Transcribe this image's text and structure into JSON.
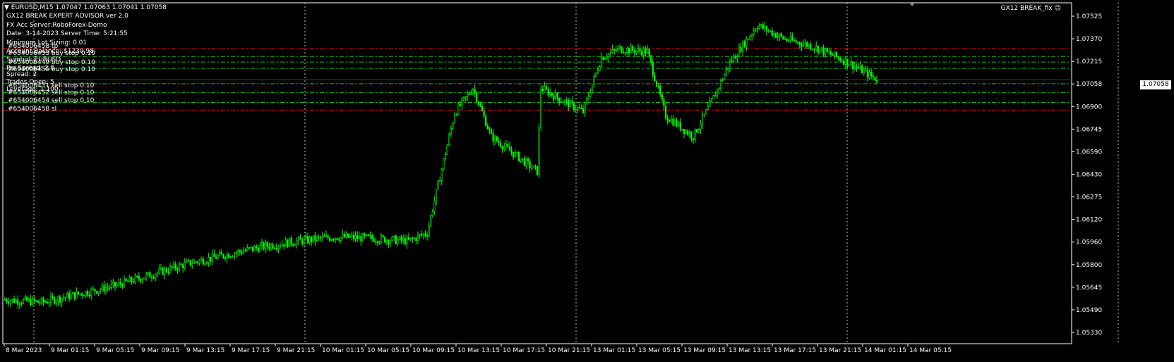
{
  "header": {
    "symbol_line": "EURUSD,M15  1.07047 1.07063 1.07041 1.07058",
    "ea_name": "GX12 BREAK_fix"
  },
  "ea_info": [
    "GX12 BREAK EXPERT ADVISOR ver 2.0",
    "FX Acc Server:RoboForex-Demo",
    "Date: 3-14-2023 Server Time: 5:21:55",
    "Minimum Lot Sizing: 0.01",
    "Account Balance:  $1230.98",
    "Symbol: EURUSD",
    "Pip Spread:  2.0",
    "Spread: 2",
    "Trades Open: 5",
    "Leverage: 1:100"
  ],
  "orders": [
    "#654006458 tp",
    "#654006453 buy stop 0.10",
    "#654006449 buy stop 0.10",
    "#654006455 buy stop 0.10",
    "#654006451 sell stop 0.10",
    "#654006452 sell stop 0.10",
    "#654006454 sell stop 0.10",
    "#654006458 sl"
  ],
  "current_price": "1.07058",
  "colors": {
    "background": "#000000",
    "candle": "#00ff00",
    "grid": "#c0c0c0",
    "tp_sl_line": "#ff0000",
    "order_line": "#00c800",
    "text": "#ffffff"
  },
  "chart_data": {
    "type": "candlestick",
    "symbol": "EURUSD",
    "timeframe": "M15",
    "ylim": [
      1.0533,
      1.0755
    ],
    "y_ticks": [
      "1.07525",
      "1.07370",
      "1.07215",
      "1.07058",
      "1.06900",
      "1.06745",
      "1.06590",
      "1.06430",
      "1.06275",
      "1.06120",
      "1.05960",
      "1.05800",
      "1.05645",
      "1.05490",
      "1.05330"
    ],
    "x_ticks": [
      "8 Mar 2023",
      "9 Mar 01:15",
      "9 Mar 05:15",
      "9 Mar 09:15",
      "9 Mar 13:15",
      "9 Mar 17:15",
      "9 Mar 21:15",
      "10 Mar 01:15",
      "10 Mar 05:15",
      "10 Mar 09:15",
      "10 Mar 13:15",
      "10 Mar 17:15",
      "10 Mar 21:15",
      "13 Mar 01:15",
      "13 Mar 05:15",
      "13 Mar 09:15",
      "13 Mar 13:15",
      "13 Mar 17:15",
      "13 Mar 21:15",
      "14 Mar 01:15",
      "14 Mar 05:15"
    ],
    "price_key_points": [
      [
        0,
        1.0548
      ],
      [
        20,
        1.0546
      ],
      [
        40,
        1.0552
      ],
      [
        60,
        1.0558
      ],
      [
        80,
        1.0566
      ],
      [
        100,
        1.0574
      ],
      [
        120,
        1.058
      ],
      [
        140,
        1.0586
      ],
      [
        160,
        1.059
      ],
      [
        180,
        1.0593
      ],
      [
        200,
        1.0592
      ],
      [
        220,
        1.059
      ],
      [
        230,
        1.0596
      ],
      [
        245,
        1.0682
      ],
      [
        255,
        1.07
      ],
      [
        265,
        1.0665
      ],
      [
        280,
        1.065
      ],
      [
        290,
        1.064
      ],
      [
        292,
        1.07
      ],
      [
        305,
        1.069
      ],
      [
        315,
        1.0683
      ],
      [
        325,
        1.0722
      ],
      [
        335,
        1.0728
      ],
      [
        350,
        1.0726
      ],
      [
        360,
        1.068
      ],
      [
        375,
        1.0665
      ],
      [
        385,
        1.069
      ],
      [
        395,
        1.0718
      ],
      [
        410,
        1.0745
      ],
      [
        425,
        1.0735
      ],
      [
        440,
        1.073
      ],
      [
        460,
        1.0718
      ],
      [
        475,
        1.0706
      ]
    ],
    "order_levels": [
      {
        "label": "tp",
        "price": 1.07282,
        "color": "tp_sl_line"
      },
      {
        "label": "buy stop",
        "price": 1.07225,
        "color": "order_line"
      },
      {
        "label": "buy stop",
        "price": 1.07185,
        "color": "order_line"
      },
      {
        "label": "buy stop",
        "price": 1.0714,
        "color": "order_line"
      },
      {
        "label": "sell stop",
        "price": 1.0703,
        "color": "order_line"
      },
      {
        "label": "sell stop",
        "price": 1.06965,
        "color": "order_line"
      },
      {
        "label": "sell stop",
        "price": 1.06895,
        "color": "order_line"
      },
      {
        "label": "sl",
        "price": 1.0684,
        "color": "tp_sl_line"
      }
    ],
    "current_price": 1.07058,
    "grid": "vertical dotted"
  }
}
